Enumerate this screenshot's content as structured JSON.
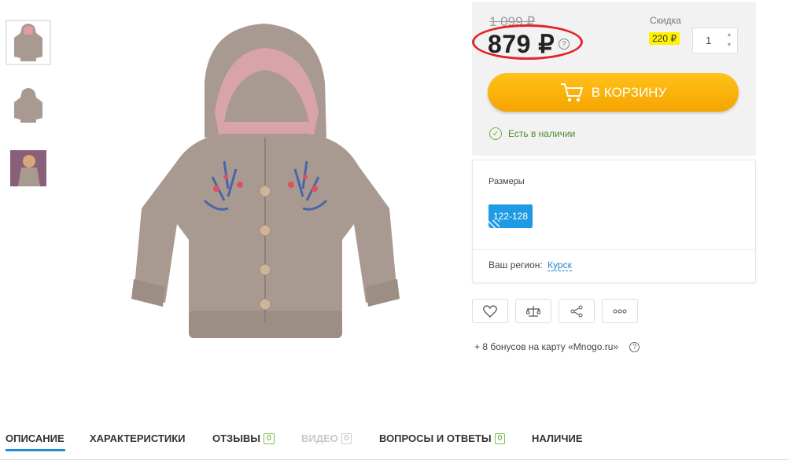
{
  "price": {
    "old": "1 099 ₽",
    "current": "879 ₽",
    "help": "?",
    "discount_label": "Скидка",
    "discount_value": "220 ₽",
    "quantity": "1"
  },
  "cart": {
    "label": "В КОРЗИНУ"
  },
  "stock": {
    "label": "Есть в наличии"
  },
  "sizes": {
    "label": "Размеры",
    "selected": "122-128"
  },
  "region": {
    "label": "Ваш регион:",
    "city": "Курск"
  },
  "actions": [
    "heart-icon",
    "compare-icon",
    "share-icon",
    "more-icon"
  ],
  "bonus": {
    "text": "+ 8 бонусов на карту «Mnogo.ru»",
    "help": "?"
  },
  "tabs": [
    {
      "label": "ОПИСАНИЕ",
      "active": true
    },
    {
      "label": "ХАРАКТЕРИСТИКИ"
    },
    {
      "label": "ОТЗЫВЫ",
      "count": "0"
    },
    {
      "label": "ВИДЕО",
      "count": "0",
      "disabled": true
    },
    {
      "label": "ВОПРОСЫ И ОТВЕТЫ",
      "count": "0"
    },
    {
      "label": "НАЛИЧИЕ"
    }
  ],
  "colors": {
    "accent": "#1b8fd7",
    "cart": "#f5a400",
    "oval": "#e0262a",
    "size_chip": "#1e9be3",
    "jacket": "#a99a91"
  }
}
